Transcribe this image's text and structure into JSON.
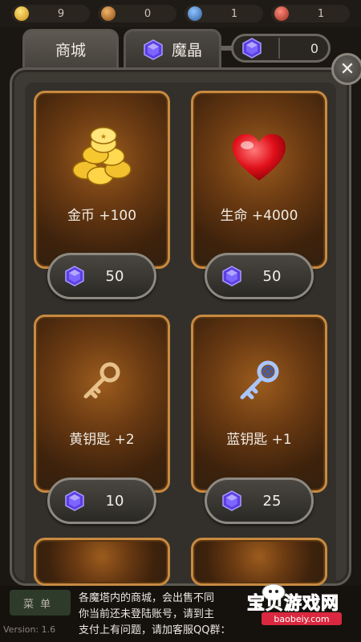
{
  "topbar": {
    "resources": [
      {
        "name": "gold",
        "icon": "coin-icon",
        "value": "9"
      },
      {
        "name": "yellow-key",
        "icon": "yellow-key-icon",
        "value": "0"
      },
      {
        "name": "blue-key",
        "icon": "blue-key-icon",
        "value": "1"
      },
      {
        "name": "red-key",
        "icon": "red-key-icon",
        "value": "1"
      }
    ]
  },
  "tabs": {
    "shop_label": "商城",
    "crystal_label": "魔晶"
  },
  "crystal_balance": "0",
  "items": [
    {
      "label": "金币 +100",
      "icon": "gold-coins-icon",
      "price": "50"
    },
    {
      "label": "生命 +4000",
      "icon": "heart-icon",
      "price": "50"
    },
    {
      "label": "黄钥匙 +2",
      "icon": "yellow-key-icon",
      "price": "10"
    },
    {
      "label": "蓝钥匙 +1",
      "icon": "blue-key-icon",
      "price": "25"
    }
  ],
  "bottom": {
    "menu_label": "菜单",
    "notice_lines": [
      "各魔塔内的商城，会出售不同",
      "你当前还未登陆账号，请到主",
      "支付上有问题，请加客服QQ群："
    ],
    "version": "Version: 1.6"
  },
  "watermark": {
    "text": "宝贝游戏网",
    "url": "baobeiy.com"
  },
  "colors": {
    "card_border": "#c88a40",
    "gem": "#6a4df0",
    "accent_red": "#ff2e4f"
  }
}
